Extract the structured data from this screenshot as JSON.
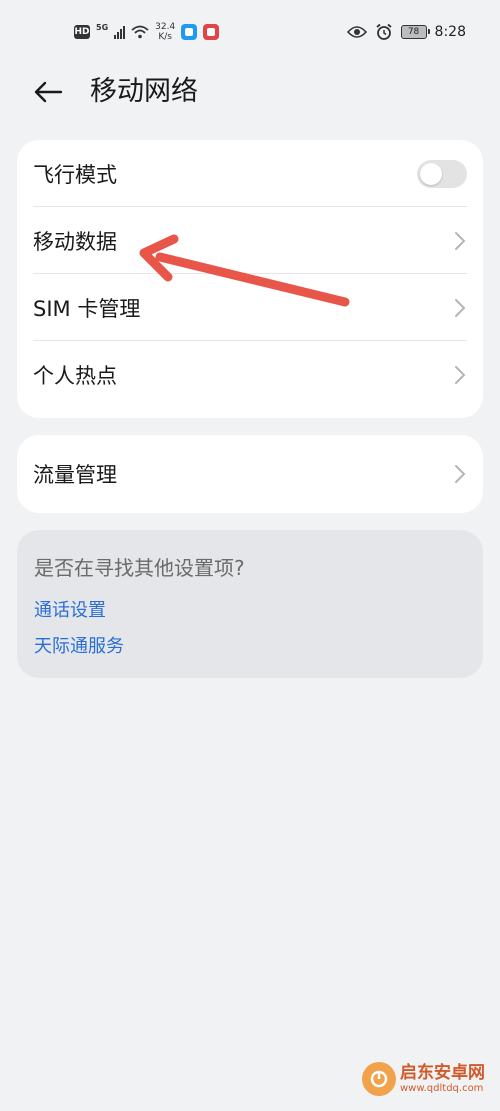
{
  "status_bar": {
    "hd": "HD",
    "network": "5G",
    "speed_value": "32.4",
    "speed_unit": "K/s",
    "battery": "78",
    "time": "8:28"
  },
  "header": {
    "title": "移动网络"
  },
  "settings": {
    "items": [
      {
        "label": "飞行模式",
        "type": "toggle",
        "enabled": false
      },
      {
        "label": "移动数据",
        "type": "link"
      },
      {
        "label": "SIM 卡管理",
        "type": "link"
      },
      {
        "label": "个人热点",
        "type": "link"
      }
    ],
    "traffic": {
      "label": "流量管理"
    }
  },
  "suggestion": {
    "title": "是否在寻找其他设置项?",
    "links": [
      "通话设置",
      "天际通服务"
    ]
  },
  "watermark": {
    "main": "启东安卓网",
    "sub": "www.qdltdq.com"
  },
  "colors": {
    "background": "#f1f2f4",
    "card": "#ffffff",
    "link": "#2a6fd6",
    "annotation": "#e8564a"
  }
}
